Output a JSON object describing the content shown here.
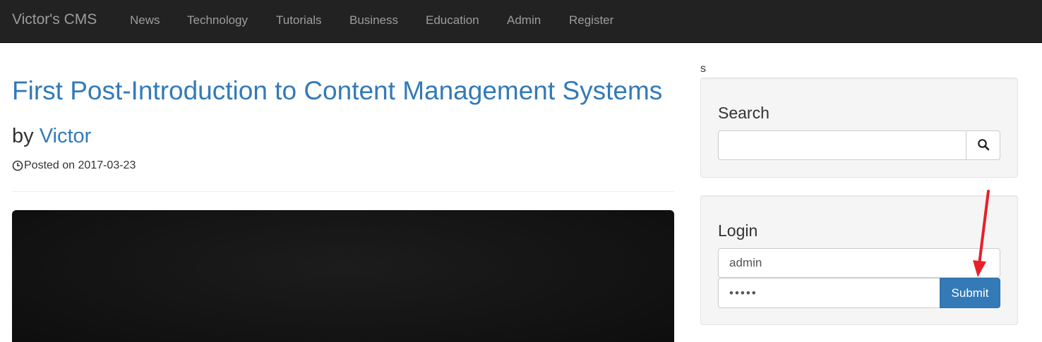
{
  "navbar": {
    "brand": "Victor's CMS",
    "items": [
      {
        "label": "News"
      },
      {
        "label": "Technology"
      },
      {
        "label": "Tutorials"
      },
      {
        "label": "Business"
      },
      {
        "label": "Education"
      },
      {
        "label": "Admin"
      },
      {
        "label": "Register"
      }
    ]
  },
  "post": {
    "title": "First Post-Introduction to Content Management Systems",
    "by_prefix": "by",
    "author": "Victor",
    "posted_label": "Posted on 2017-03-23",
    "icon": "clock-icon"
  },
  "sidebar": {
    "stray_text": "s",
    "search": {
      "heading": "Search",
      "value": "",
      "button_icon": "search-icon"
    },
    "login": {
      "heading": "Login",
      "username_value": "admin",
      "password_value": "•••••",
      "submit_label": "Submit"
    }
  },
  "colors": {
    "navbar_bg": "#222222",
    "link": "#337ab7",
    "primary_button": "#337ab7",
    "annotation_arrow": "#e8202a"
  }
}
